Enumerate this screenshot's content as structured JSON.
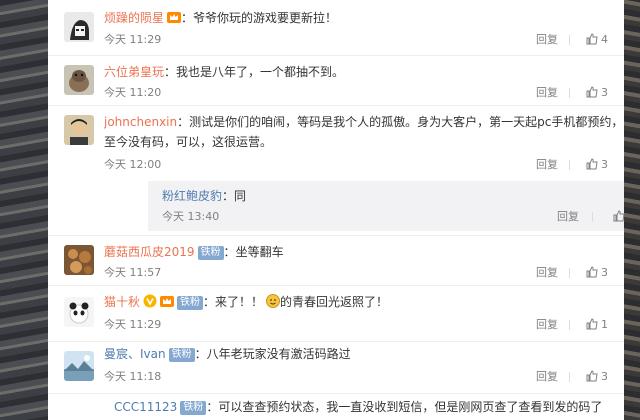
{
  "colors": {
    "name_orange": "#eb7350",
    "name_blue": "#507daf",
    "badge": "#85a8d1",
    "meta": "#808080"
  },
  "comments": [
    {
      "user": "烦躁的陨星",
      "text": "爷爷你玩的游戏要更新拉！",
      "time": "今天 11:29",
      "reply": "回复",
      "likes": "4",
      "icon": "vip-crown-icon"
    },
    {
      "user": "六位弟皇玩",
      "text": "我也是八年了，一个都抽不到。",
      "time": "今天 11:20",
      "reply": "回复",
      "likes": "3"
    },
    {
      "user": "johnchenxin",
      "text": "测试是你们的咱闹，等码是我个人的孤傲。身为大客户，第一天起pc手机都预约，",
      "text2": "至今没有码，可以，这很运营。",
      "time": "今天 12:00",
      "reply": "回复",
      "likes": "3"
    },
    {
      "user": "蘑菇西瓜皮2019",
      "badge": "铁粉",
      "text": "坐等翻车",
      "time": "今天 11:57",
      "reply": "回复",
      "likes": "3"
    },
    {
      "user": "猫十秋",
      "badge": "铁粉",
      "text": "来了！！",
      "text_b": "的青春回光返照了！",
      "time": "今天 11:29",
      "reply": "回复",
      "likes": "1"
    },
    {
      "user": "曼宸、Ivan",
      "badge": "铁粉",
      "text": "八年老玩家没有激活码路过",
      "time": "今天 11:18",
      "reply": "回复",
      "likes": "3"
    },
    {
      "user": "CCC11123",
      "badge": "铁粉",
      "text": "可以查查预约状态，我一直没收到短信，但是刚网页查了查看到发的码了"
    }
  ],
  "subreply": {
    "user": "粉红鲍皮豹",
    "text": "同",
    "time": "今天 13:40",
    "reply": "回复",
    "like_label": "赞"
  }
}
